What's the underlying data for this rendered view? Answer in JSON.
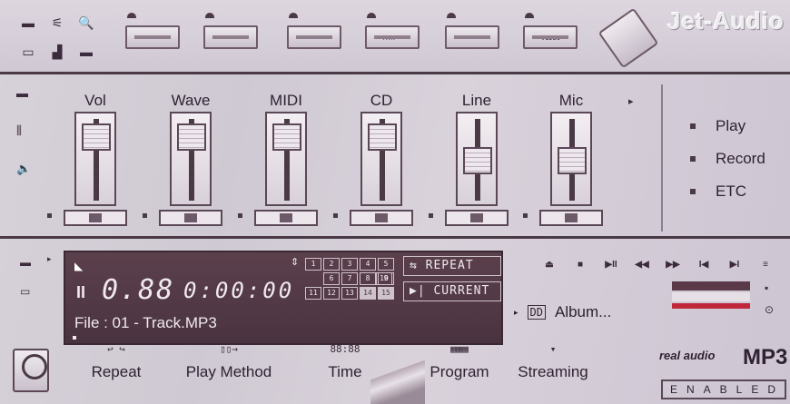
{
  "app": {
    "logo": "Jet-Audio",
    "accent": "#4a3340"
  },
  "device_bar": {
    "mini_tools": [
      "grid-icon",
      "plug-icon",
      "search-icon",
      "monitor-icon",
      "chart-icon",
      "menu-icon"
    ],
    "devices": [
      {
        "name": "equalizer-device",
        "tag": ""
      },
      {
        "name": "amplifier-device",
        "tag": ""
      },
      {
        "name": "tuner-device",
        "tag": ""
      },
      {
        "name": "cd-deck-device",
        "tag": "MTR"
      },
      {
        "name": "tape-deck-device",
        "tag": ""
      },
      {
        "name": "video-deck-device",
        "tag": "VIDEO"
      }
    ]
  },
  "mixer": {
    "channels": [
      {
        "label": "Vol",
        "level": 0.9
      },
      {
        "label": "Wave",
        "level": 0.9
      },
      {
        "label": "MIDI",
        "level": 0.9
      },
      {
        "label": "CD",
        "level": 0.9
      },
      {
        "label": "Line",
        "level": 0.5
      },
      {
        "label": "Mic",
        "level": 0.5
      }
    ],
    "options": [
      "Play",
      "Record",
      "ETC"
    ]
  },
  "player": {
    "track_number": "0.88",
    "time": "0:00:00",
    "file": "File : 01 - Track.MP3",
    "track_buttons": [
      [
        "1",
        "2",
        "3",
        "4",
        "5"
      ],
      [
        "",
        "6",
        "7",
        "8",
        "9",
        "10"
      ],
      [
        "11",
        "12",
        "13",
        "14",
        "15"
      ]
    ],
    "repeat_btn": "⇆ REPEAT",
    "current_btn": "▶| CURRENT",
    "album": "Album...",
    "vu_colors": [
      "#5a3a48",
      "#e6e0e6",
      "#c0283a"
    ]
  },
  "bottom_tools": [
    {
      "label": "Repeat",
      "icon": "↩ ↪"
    },
    {
      "label": "Play Method",
      "icon": "▯▯→"
    },
    {
      "label": "Time",
      "icon": "88:88"
    },
    {
      "label": "Program",
      "icon": "▦▦▦"
    },
    {
      "label": "Streaming",
      "icon": "▾"
    }
  ],
  "branding": {
    "real_audio": "real audio",
    "mp3": "MP3",
    "enabled": "ENABLED"
  }
}
